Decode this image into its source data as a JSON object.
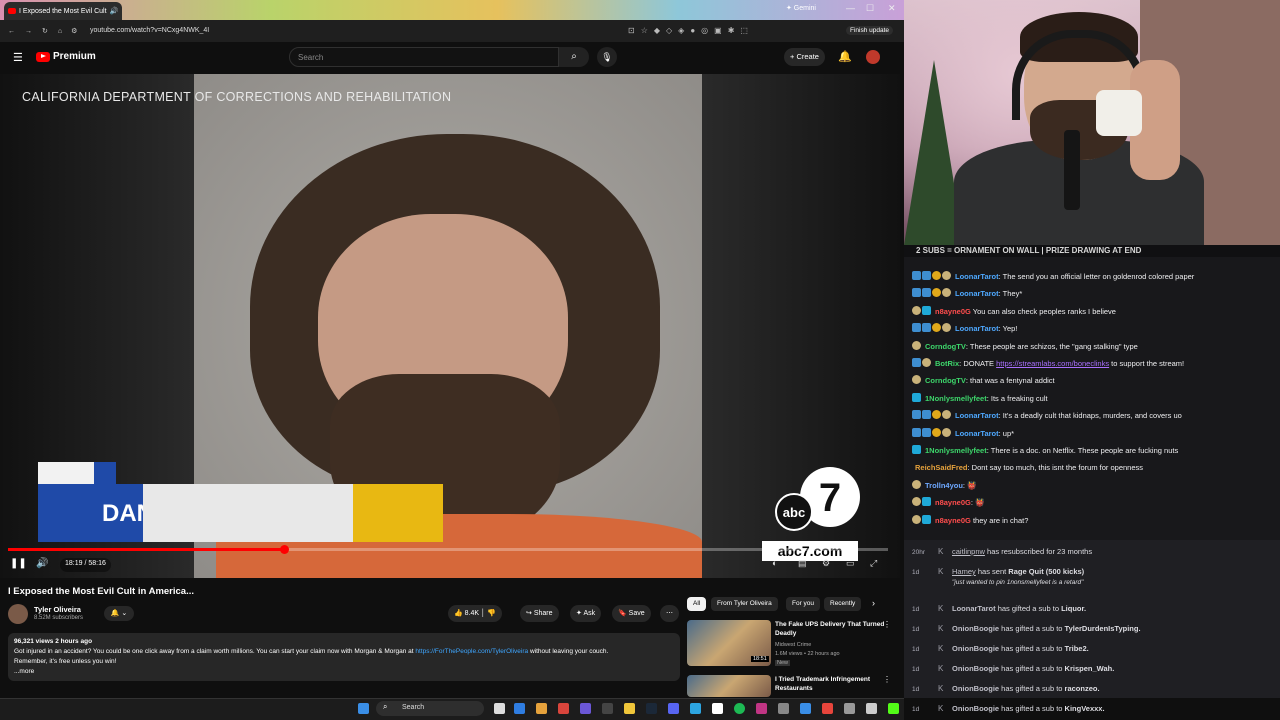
{
  "browser": {
    "tab_title": "I Exposed the Most Evil Cult",
    "gemini": "✦ Gemini",
    "url": "youtube.com/watch?v=NCxg4NWK_4I",
    "finish_update": "Finish update"
  },
  "youtube": {
    "logo": "Premium",
    "search_placeholder": "Search",
    "create": "+ Create"
  },
  "video": {
    "overlay_text": "CALIFORNIA DEPARTMENT OF CORRECTIONS AND REHABILITATION",
    "lower_third": "DAN",
    "abc_logo": "abc",
    "abc_seven": "7",
    "abc_url": "abc7.com",
    "time": "18:19 / 58:16",
    "progress": 0.314
  },
  "below": {
    "title": "I Exposed the Most Evil Cult in America...",
    "channel": "Tyler Oliveira",
    "subs": "8.52M subscribers",
    "likes": "8.4K",
    "share": "Share",
    "ask": "Ask",
    "save": "Save",
    "views": "96,321 views  2 hours ago",
    "desc_line1": "Got injured in an accident? You could be one click away from a claim worth millions. You can start your claim now with Morgan & Morgan at",
    "desc_link": "https://ForThePeople.com/TylerOliveira",
    "desc_line1_end": "without leaving your couch.",
    "desc_line2": "Remember, it's free unless you win!",
    "more": "...more"
  },
  "chips": [
    "All",
    "From Tyler Oliveira",
    "For you",
    "Recently"
  ],
  "recs": [
    {
      "title": "The Fake UPS Delivery That Turned Deadly",
      "channel": "Midwest Crime",
      "meta": "1.6M views • 22 hours ago",
      "badge": "New",
      "dur": "18:51"
    },
    {
      "title": "I Tried Trademark Infringement Restaurants",
      "channel": "",
      "meta": "",
      "badge": "",
      "dur": ""
    }
  ],
  "taskbar": {
    "search": "Search"
  },
  "chat": {
    "banner": "2 SUBS = ORNAMENT ON WALL | PRIZE DRAWING AT END",
    "messages": [
      {
        "user": "LoonarTarot",
        "color": "#4ea8ff",
        "text": ": The send you an official letter on goldenrod colored paper",
        "badges": "bbyg"
      },
      {
        "user": "LoonarTarot",
        "color": "#4ea8ff",
        "text": ": They*",
        "badges": "bbyg"
      },
      {
        "user": "n8ayne0G",
        "color": "#ff4d4d",
        "text": " You can also check peoples ranks I believe",
        "badges": "gc"
      },
      {
        "user": "LoonarTarot",
        "color": "#4ea8ff",
        "text": ": Yep!",
        "badges": "bbyg"
      },
      {
        "user": "CorndogTV",
        "color": "#3dd66b",
        "text": ": These people are schizos, the \"gang stalking\" type",
        "badges": "g"
      },
      {
        "user": "BotRix",
        "color": "#3dd66b",
        "text": ": DONATE ",
        "link": "https://streamlabs.com/boneclinks",
        "text2": " to support the stream!",
        "badges": "bg"
      },
      {
        "user": "CorndogTV",
        "color": "#3dd66b",
        "text": ": that was a fentynal addict",
        "badges": "g"
      },
      {
        "user": "1Nonlysmellyfeet",
        "color": "#3dd66b",
        "text": ": Its a freaking cult",
        "badges": "c"
      },
      {
        "user": "LoonarTarot",
        "color": "#4ea8ff",
        "text": ": It's a deadly cult that kidnaps, murders, and covers uo",
        "badges": "bbyg"
      },
      {
        "user": "LoonarTarot",
        "color": "#4ea8ff",
        "text": ": up*",
        "badges": "bbyg"
      },
      {
        "user": "1Nonlysmellyfeet",
        "color": "#3dd66b",
        "text": ": There is a doc. on Netflix. These people are fucking nuts",
        "badges": "c"
      },
      {
        "user": "ReichSaidFred",
        "color": "#e6a23c",
        "text": ": Dont say too much, this isnt the forum for openness",
        "badges": ""
      },
      {
        "user": "Trolln4you",
        "color": "#6ea8ff",
        "text": ": 👹",
        "badges": "g"
      },
      {
        "user": "n8ayne0G",
        "color": "#ff4d4d",
        "text": ": 👹",
        "badges": "gc"
      },
      {
        "user": "n8ayne0G",
        "color": "#ff4d4d",
        "text": " they are in chat?",
        "badges": "gc"
      }
    ],
    "events": [
      {
        "time": "20hr",
        "name": "caitlinpnw",
        "text": " has resubscribed for 23 months",
        "extra": ""
      },
      {
        "time": "1d",
        "name": "Hamey",
        "text": " has sent ",
        "bold": "Rage Quit (500 kicks)",
        "extra": "\"just wanted to pin 1nonsmellyfeet is a retard\""
      },
      {
        "time": "1d",
        "name": "LoonarTarot",
        "text": " has gifted a sub to ",
        "bold": "Liquor."
      },
      {
        "time": "1d",
        "name": "OnionBoogie",
        "text": " has gifted a sub to ",
        "bold": "TylerDurdenIsTyping."
      },
      {
        "time": "1d",
        "name": "OnionBoogie",
        "text": " has gifted a sub to ",
        "bold": "Tribe2."
      },
      {
        "time": "1d",
        "name": "OnionBoogie",
        "text": " has gifted a sub to ",
        "bold": "Krispen_Wah."
      },
      {
        "time": "1d",
        "name": "OnionBoogie",
        "text": " has gifted a sub to ",
        "bold": "raconzeo."
      },
      {
        "time": "1d",
        "name": "OnionBoogie",
        "text": " has gifted a sub to ",
        "bold": "KingVexxx."
      }
    ]
  }
}
